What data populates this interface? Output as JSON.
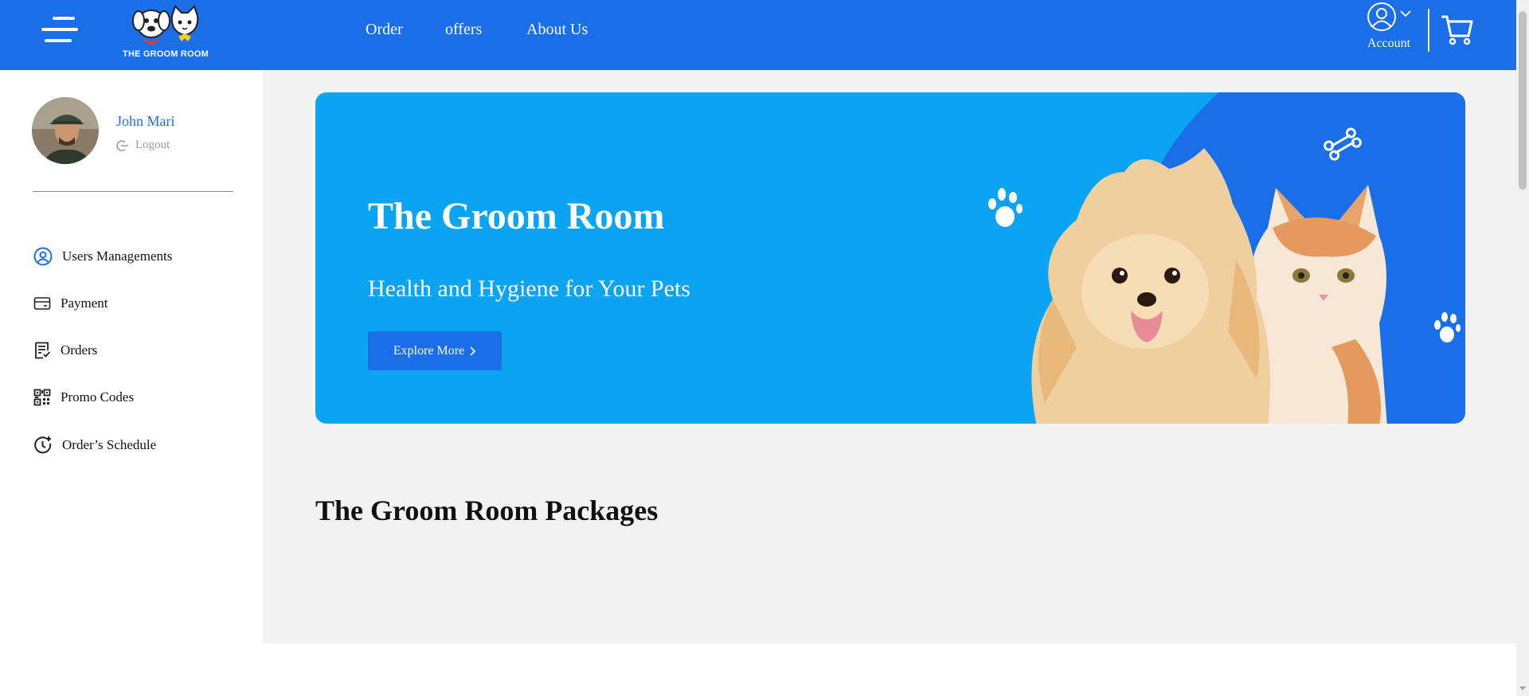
{
  "header": {
    "brand": "THE GROOM ROOM",
    "nav": [
      "Order",
      "offers",
      "About Us"
    ],
    "account_label": "Account"
  },
  "sidebar": {
    "user_name": "John Mari",
    "logout_label": "Logout",
    "items": [
      {
        "label": "Users Managements",
        "icon": "user-circle-icon"
      },
      {
        "label": "Payment",
        "icon": "card-icon"
      },
      {
        "label": "Orders",
        "icon": "receipt-icon"
      },
      {
        "label": "Promo Codes",
        "icon": "qr-code-icon"
      },
      {
        "label": "Order’s Schedule",
        "icon": "clock-plus-icon"
      }
    ]
  },
  "hero": {
    "title": "The Groom Room",
    "subtitle": "Health and Hygiene for Your Pets",
    "button_label": "Explore More",
    "button_icon": "chevron-right-icon"
  },
  "packages": {
    "title": "The Groom Room Packages"
  },
  "colors": {
    "primary": "#1a6fe8",
    "hero_bg": "#0aa4f2",
    "main_bg": "#f3f3f3"
  }
}
